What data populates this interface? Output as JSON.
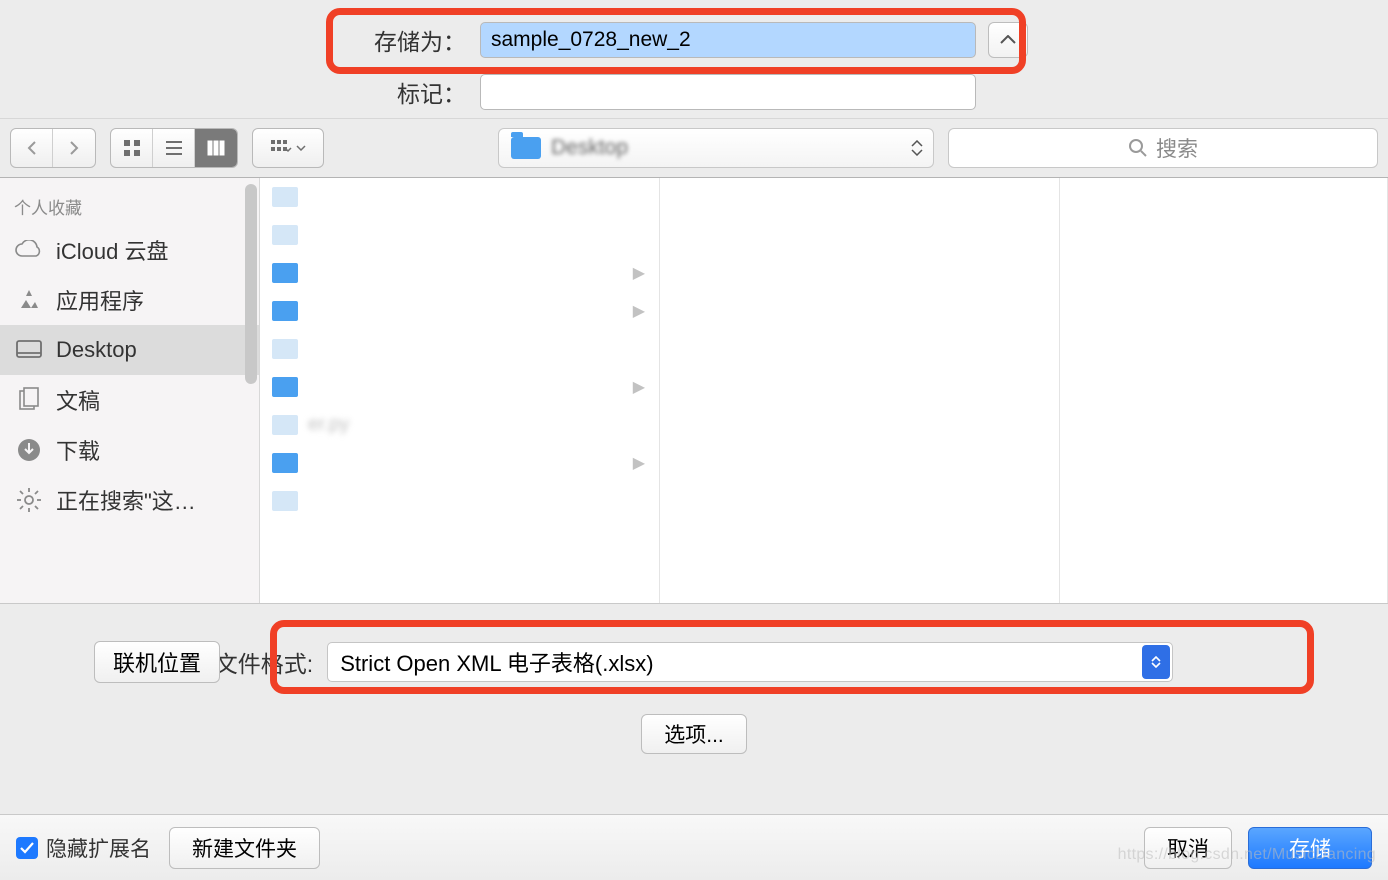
{
  "labels": {
    "save_as": "存储为：",
    "tags": "标记：",
    "search_placeholder": "搜索",
    "file_format": "文件格式:",
    "online": "联机位置",
    "options": "选项...",
    "hide_ext": "隐藏扩展名",
    "new_folder": "新建文件夹",
    "cancel": "取消",
    "save": "存储"
  },
  "values": {
    "filename": "sample_0728_new_2",
    "tags": "",
    "location": "Desktop",
    "format": "Strict Open XML 电子表格(.xlsx)",
    "hide_ext_checked": true
  },
  "sidebar": {
    "heading": "个人收藏",
    "items": [
      {
        "label": "iCloud 云盘",
        "icon": "cloud"
      },
      {
        "label": "应用程序",
        "icon": "apps"
      },
      {
        "label": "Desktop",
        "icon": "desktop",
        "selected": true
      },
      {
        "label": "文稿",
        "icon": "docs"
      },
      {
        "label": "下载",
        "icon": "downloads"
      },
      {
        "label": "正在搜索\"这…",
        "icon": "gear"
      }
    ]
  },
  "files": [
    {
      "name": " "
    },
    {
      "name": " "
    },
    {
      "name": " ",
      "folder": true
    },
    {
      "name": " ",
      "folder": true
    },
    {
      "name": " "
    },
    {
      "name": " ",
      "folder": true
    },
    {
      "name": "er.py"
    },
    {
      "name": " ",
      "folder": true
    },
    {
      "name": " "
    }
  ],
  "watermark": "https://blog.csdn.net/MusicDancing"
}
